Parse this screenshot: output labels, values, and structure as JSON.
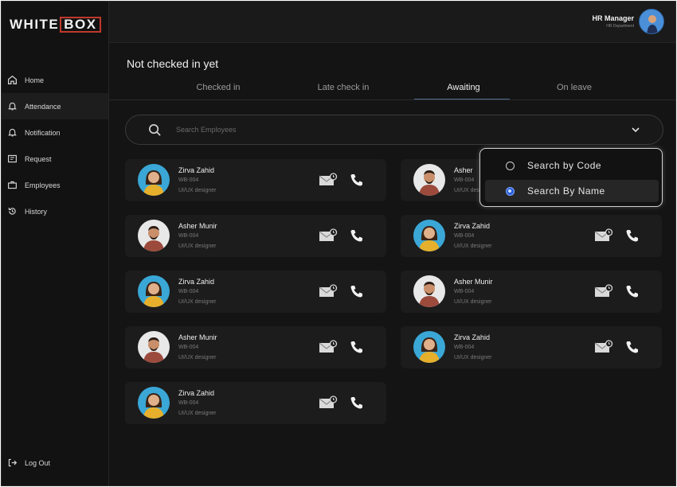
{
  "app": {
    "logo_prefix": "WHITE",
    "logo_box": "BOX"
  },
  "user": {
    "name": "HR Manager",
    "department": "HR Department"
  },
  "sidebar": {
    "items": [
      {
        "label": "Home",
        "icon": "home-icon"
      },
      {
        "label": "Attendance",
        "icon": "bell-icon"
      },
      {
        "label": "Notification",
        "icon": "bell-icon"
      },
      {
        "label": "Request",
        "icon": "request-icon"
      },
      {
        "label": "Employees",
        "icon": "briefcase-icon"
      },
      {
        "label": "History",
        "icon": "history-icon"
      }
    ],
    "logout": "Log Out"
  },
  "main": {
    "title": "Not checked in yet",
    "tabs": [
      {
        "label": "Checked in"
      },
      {
        "label": "Late check in"
      },
      {
        "label": "Awaiting"
      },
      {
        "label": "On leave"
      }
    ],
    "active_tab": "Awaiting",
    "search": {
      "placeholder": "Search Employees"
    }
  },
  "dropdown": {
    "options": [
      {
        "label": "Search by Code",
        "selected": false
      },
      {
        "label": "Search By Name",
        "selected": true
      }
    ]
  },
  "employees": [
    {
      "name": "Zirva Zahid",
      "code": "WB-004",
      "role": "UI/UX designer"
    },
    {
      "name": "Asher",
      "code": "WB-004",
      "role": "UI/UX designer"
    },
    {
      "name": "Asher Munir",
      "code": "WB-004",
      "role": "UI/UX designer"
    },
    {
      "name": "Zirva Zahid",
      "code": "WB-004",
      "role": "UI/UX designer"
    },
    {
      "name": "Zirva Zahid",
      "code": "WB-004",
      "role": "UI/UX designer"
    },
    {
      "name": "Asher Munir",
      "code": "WB-004",
      "role": "UI/UX designer"
    },
    {
      "name": "Asher Munir",
      "code": "WB-004",
      "role": "UI/UX designer"
    },
    {
      "name": "Zirva Zahid",
      "code": "WB-004",
      "role": "UI/UX designer"
    },
    {
      "name": "Zirva Zahid",
      "code": "WB-004",
      "role": "UI/UX designer"
    }
  ],
  "colors": {
    "accent": "#4f6b8f",
    "logo_box": "#c0392b",
    "radio_selected": "#2b5fd9"
  }
}
